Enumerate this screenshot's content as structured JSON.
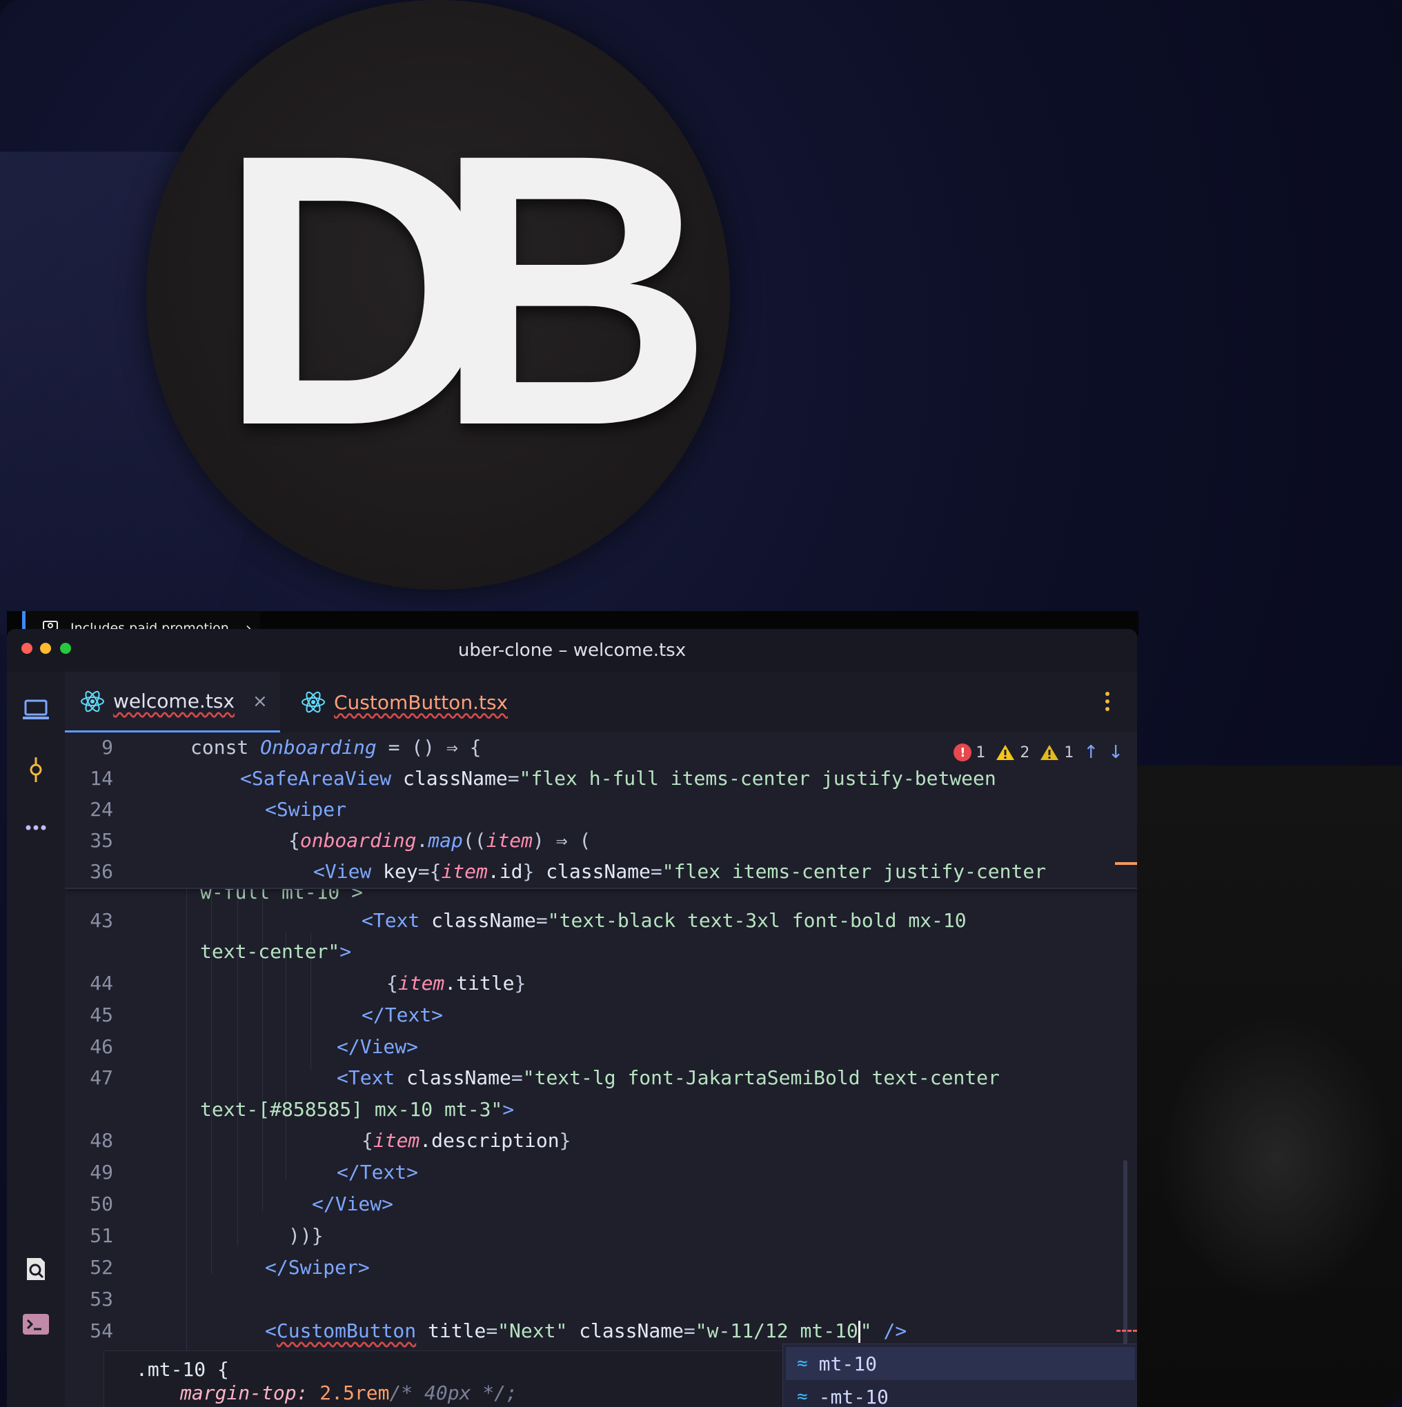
{
  "logo": {
    "text": "DB"
  },
  "promo": {
    "label": "Includes paid promotion",
    "chevron": "›"
  },
  "window": {
    "title": "uber-clone – welcome.tsx"
  },
  "activity_bar": {
    "items": [
      "laptop-icon",
      "git-commit-icon",
      "more-icon",
      "search-file-icon",
      "terminal-icon"
    ]
  },
  "tabs": [
    {
      "label": "welcome.tsx",
      "active": true,
      "close": "×"
    },
    {
      "label": "CustomButton.tsx",
      "active": false
    }
  ],
  "problems": {
    "errors": "1",
    "warnings": "2",
    "weak_warnings": "1"
  },
  "sticky_lines": [
    {
      "n": "9",
      "text": "const Onboarding = () ⇒ {"
    },
    {
      "n": "14",
      "text": "<SafeAreaView className=\"flex h-full items-center justify-between"
    },
    {
      "n": "24",
      "text": "<Swiper"
    },
    {
      "n": "35",
      "text": "{onboarding.map((item) ⇒ ("
    },
    {
      "n": "36",
      "text": "<View key={item.id} className=\"flex items-center justify-center"
    }
  ],
  "code": {
    "partial": "w-full mt-10 >",
    "l43a": "<Text className=\"text-black text-3xl font-bold mx-10",
    "l43b": "text-center\">",
    "l44": "{item.title}",
    "l45": "</Text>",
    "l46": "</View>",
    "l47a": "<Text className=\"text-lg font-JakartaSemiBold text-center",
    "l47b": "text-[#858585] mx-10 mt-3\">",
    "l48": "{item.description}",
    "l49": "</Text>",
    "l50": "</View>",
    "l51": "))}",
    "l52": "</Swiper>",
    "l54": "<CustomButton title=\"Next\" className=\"w-11/12 mt-10\" />"
  },
  "line_numbers": [
    "43",
    "",
    "44",
    "45",
    "46",
    "47",
    "",
    "48",
    "49",
    "50",
    "51",
    "52",
    "53",
    "54"
  ],
  "tooltip": {
    "line1": ".mt-10 {",
    "prop": "margin-top:",
    "value": "2.5rem",
    "comment": "/* 40px */;"
  },
  "completion": {
    "items": [
      "mt-10",
      "-mt-10"
    ]
  },
  "colors": {
    "accent": "#5e9cff",
    "error": "#e5484d",
    "warning": "#f5c518",
    "tailwind": "#38bdf8"
  }
}
